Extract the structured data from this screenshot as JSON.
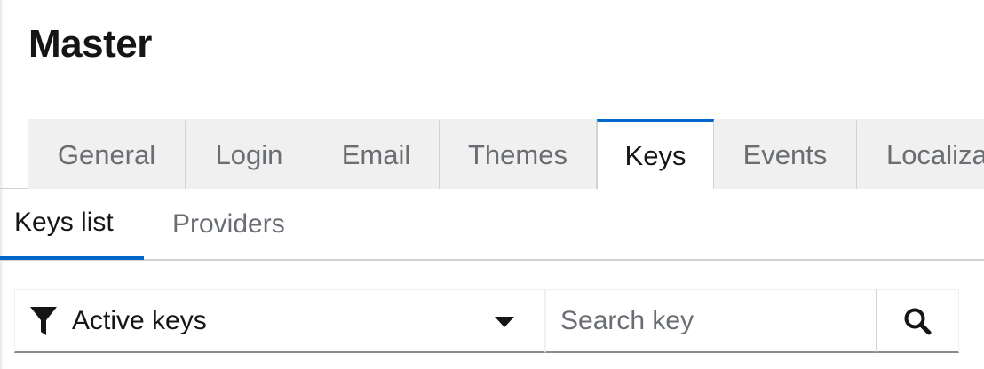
{
  "page": {
    "title": "Master"
  },
  "main_tabs": [
    {
      "label": "General",
      "active": false
    },
    {
      "label": "Login",
      "active": false
    },
    {
      "label": "Email",
      "active": false
    },
    {
      "label": "Themes",
      "active": false
    },
    {
      "label": "Keys",
      "active": true
    },
    {
      "label": "Events",
      "active": false
    },
    {
      "label": "Localiza",
      "active": false
    }
  ],
  "sub_tabs": [
    {
      "label": "Keys list",
      "active": true
    },
    {
      "label": "Providers",
      "active": false
    }
  ],
  "toolbar": {
    "filter_value": "Active keys",
    "filter_icon": "filter-icon",
    "caret_icon": "caret-down-icon",
    "search_placeholder": "Search key",
    "search_icon": "search-icon"
  },
  "colors": {
    "accent": "#0066cc",
    "tab_bg": "#f0f0f0",
    "muted_text": "#6a6e73",
    "text": "#151515"
  }
}
